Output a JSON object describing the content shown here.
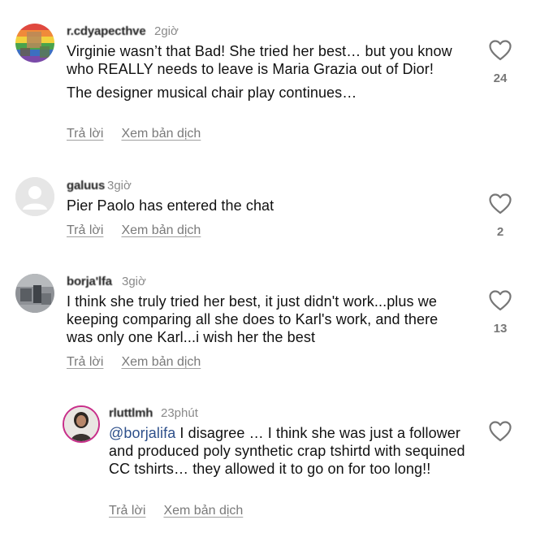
{
  "comments": [
    {
      "username": "r.cdyapecthve",
      "time": "2giờ",
      "paragraphs": [
        "Virginie wasn’t that Bad! She tried her best… but you know who REALLY needs to leave is Maria Grazia out of Dior!",
        "The designer musical chair play continues…"
      ],
      "reply_label": "Trả lời",
      "translate_label": "Xem bản dịch",
      "likes": "24"
    },
    {
      "username": "galuus",
      "time": "3giờ",
      "paragraphs": [
        "Pier Paolo has entered the chat"
      ],
      "reply_label": "Trả lời",
      "translate_label": "Xem bản dịch",
      "likes": "2"
    },
    {
      "username": "borja'lfa",
      "time": "3giờ",
      "paragraphs": [
        "I think she truly tried her best, it just didn't work...plus we keeping comparing all she does to Karl's work, and there was only one Karl...i wish her the best"
      ],
      "reply_label": "Trả lời",
      "translate_label": "Xem bản dịch",
      "likes": "13"
    },
    {
      "username": "rluttlmh",
      "time": "23phút",
      "mention": "@borjalifa",
      "paragraphs": [
        "I disagree … I think she was just a follower and produced poly synthetic crap tshirtd with sequined CC tshirts… they allowed it to go on for too long!!"
      ],
      "reply_label": "Trả lời",
      "translate_label": "Xem bản dịch",
      "likes": ""
    }
  ]
}
